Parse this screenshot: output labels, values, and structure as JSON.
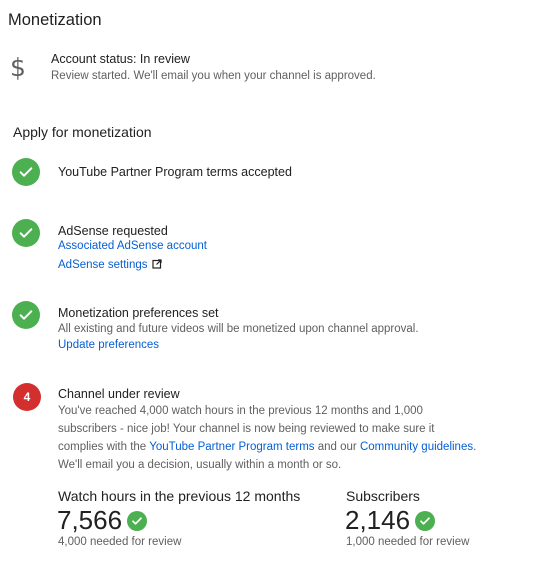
{
  "page": {
    "title": "Monetization"
  },
  "account": {
    "status": "Account status: In review",
    "description": "Review started. We'll email you when your channel is approved.",
    "icon": "dollar-icon"
  },
  "apply": {
    "heading": "Apply for monetization",
    "steps": [
      {
        "title": "YouTube Partner Program terms accepted",
        "state": "done"
      },
      {
        "title": "AdSense requested",
        "state": "done",
        "links": [
          "Associated AdSense account",
          "AdSense settings"
        ]
      },
      {
        "title": "Monetization preferences set",
        "state": "done",
        "text": "All existing and future videos will be monetized upon channel approval.",
        "links": [
          "Update preferences"
        ]
      },
      {
        "title": "Channel under review",
        "state": "current",
        "number": "4",
        "text_line1": "You've reached 4,000 watch hours in the previous 12 months and 1,000",
        "text_line2": "subscribers - nice job! Your channel is now being reviewed to make sure it",
        "text_line3_pre": "complies with the ",
        "text_line3_link1": "YouTube Partner Program terms",
        "text_line3_mid": " and our ",
        "text_line3_link2": "Community guidelines",
        "text_line3_post": ".",
        "text_line4": "We'll email you a decision, usually within a month or so."
      }
    ]
  },
  "stats": {
    "watch_hours": {
      "label": "Watch hours in the previous 12 months",
      "value": "7,566",
      "needed": "4,000 needed for review"
    },
    "subscribers": {
      "label": "Subscribers",
      "value": "2,146",
      "needed": "1,000 needed for review"
    }
  },
  "colors": {
    "success": "#4caf50",
    "alert": "#d32f2f",
    "link": "#065fd4"
  }
}
